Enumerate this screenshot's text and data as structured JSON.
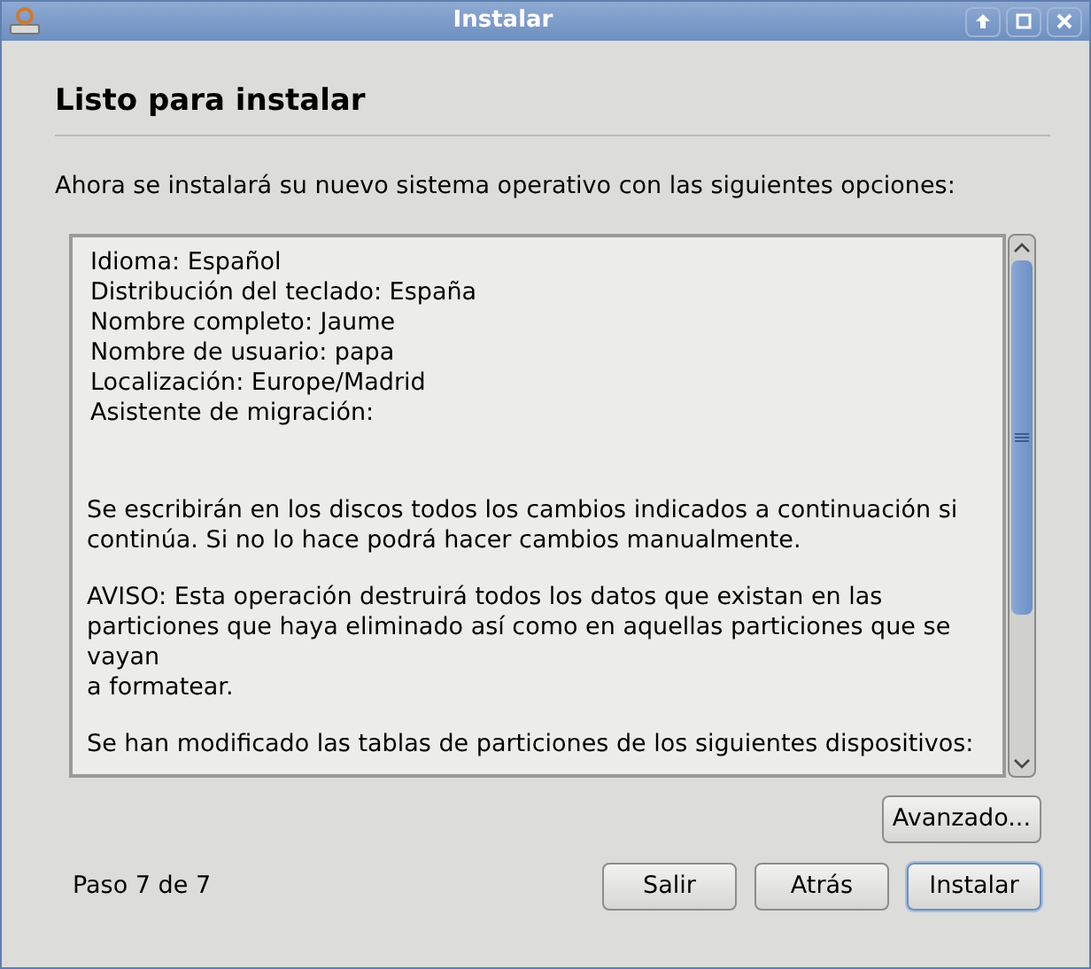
{
  "window": {
    "title": "Instalar"
  },
  "heading": "Listo para instalar",
  "intro": "Ahora se instalará su nuevo sistema operativo con las siguientes opciones:",
  "summary": {
    "settings": [
      "Idioma: Español",
      "Distribución del teclado: España",
      "Nombre completo: Jaume",
      "Nombre de usuario: papa",
      "Localización: Europe/Madrid",
      "Asistente de migración:"
    ],
    "paragraphs": [
      [
        "Se escribirán en los discos todos los cambios indicados a continuación si",
        "continúa. Si no lo hace podrá hacer cambios manualmente."
      ],
      [
        "AVISO: Esta operación destruirá todos los datos que existan en las",
        "particiones que haya eliminado así como en aquellas particiones que se",
        "vayan",
        "a formatear."
      ],
      [
        "Se han modificado las tablas de particiones de los siguientes dispositivos:"
      ]
    ]
  },
  "advanced_button": "Avanzado...",
  "step": "Paso 7 de 7",
  "buttons": [
    {
      "label": "Salir",
      "default": false
    },
    {
      "label": "Atrás",
      "default": false
    },
    {
      "label": "Instalar",
      "default": true
    }
  ]
}
